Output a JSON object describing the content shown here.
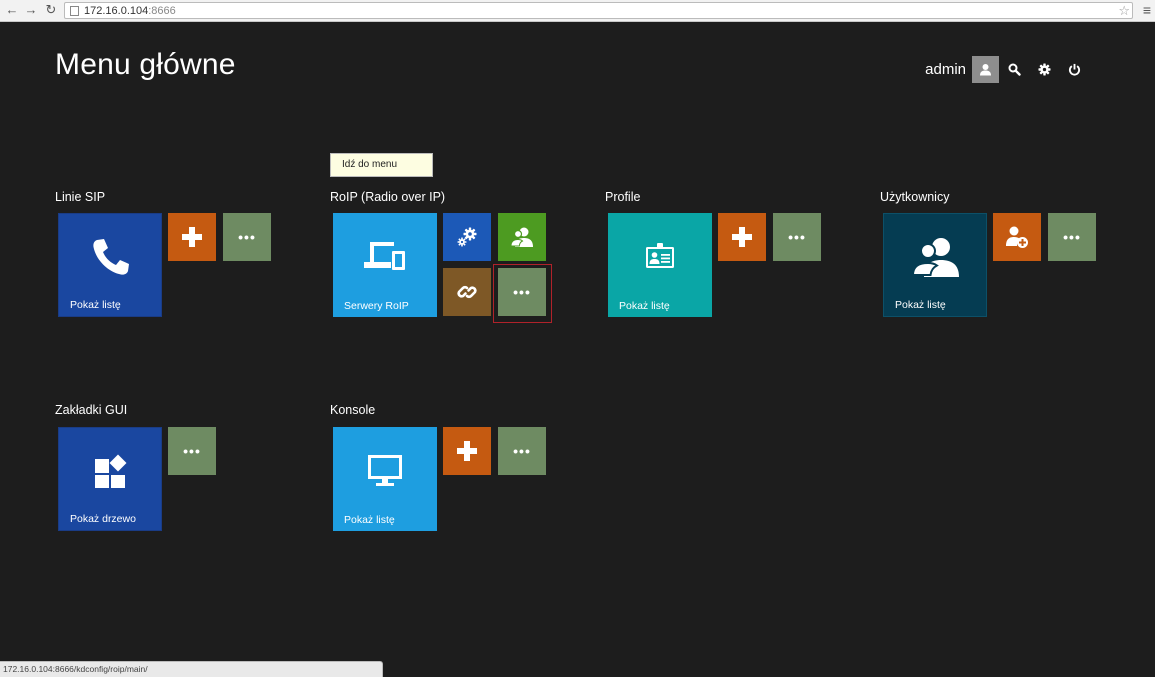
{
  "browser": {
    "url_host": "172.16.0.104",
    "url_port": ":8666",
    "status_url": "172.16.0.104:8666/kdconfig/roip/main/"
  },
  "header": {
    "title": "Menu główne",
    "username": "admin"
  },
  "tooltip": {
    "text": "Idź do menu"
  },
  "groups": {
    "sip": {
      "title": "Linie SIP",
      "main_caption": "Pokaż listę"
    },
    "roip": {
      "title": "RoIP (Radio over IP)",
      "main_caption": "Serwery RoIP"
    },
    "profile": {
      "title": "Profile",
      "main_caption": "Pokaż listę"
    },
    "users": {
      "title": "Użytkownicy",
      "main_caption": "Pokaż listę"
    },
    "gui": {
      "title": "Zakładki GUI",
      "main_caption": "Pokaż drzewo"
    },
    "consoles": {
      "title": "Konsole",
      "main_caption": "Pokaż listę"
    }
  },
  "labels": {
    "more": "•••"
  },
  "colors": {
    "background": "#1d1d1d",
    "orange": "#c55a11",
    "green": "#6e8b62",
    "cyan": "#1e9ee0",
    "teal": "#0aa6a6",
    "dark_blue": "#1a47a0",
    "navy": "#053c52",
    "selection": "#b0222a"
  }
}
